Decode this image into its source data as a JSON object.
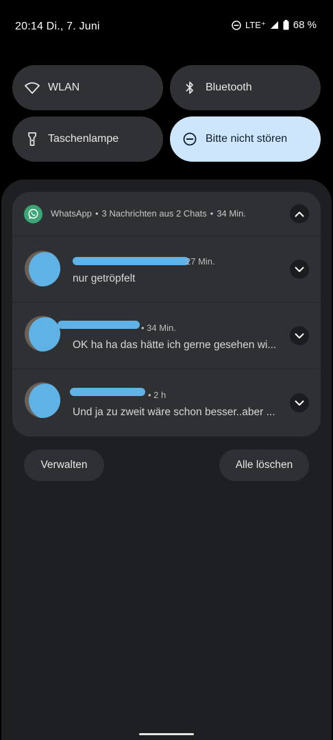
{
  "status_bar": {
    "time_date": "20:14 Di., 7. Juni",
    "network": "LTE⁺",
    "battery": "68 %",
    "icons": [
      "dnd-icon",
      "signal-icon",
      "battery-icon"
    ]
  },
  "quick_tiles": [
    {
      "label": "WLAN",
      "icon": "wifi-icon",
      "active": false
    },
    {
      "label": "Bluetooth",
      "icon": "bluetooth-icon",
      "active": false
    },
    {
      "label": "Taschenlampe",
      "icon": "flashlight-icon",
      "active": false
    },
    {
      "label": "Bitte nicht stören",
      "icon": "dnd-icon",
      "active": true
    }
  ],
  "notification": {
    "app": "WhatsApp",
    "summary": "3 Nachrichten aus 2 Chats",
    "time": "34 Min.",
    "messages": [
      {
        "time": "27 Min.",
        "text": "nur getröpfelt"
      },
      {
        "time": "34 Min.",
        "text": "OK ha ha das hätte ich gerne gesehen wi..."
      },
      {
        "time": "2 h",
        "text": "Und ja zu zweit wäre schon besser..aber ..."
      }
    ]
  },
  "actions": {
    "manage": "Verwalten",
    "clear_all": "Alle löschen"
  },
  "colors": {
    "active_tile": "#cde6fb",
    "whatsapp": "#3ba575",
    "redaction": "#5fb2e6"
  }
}
